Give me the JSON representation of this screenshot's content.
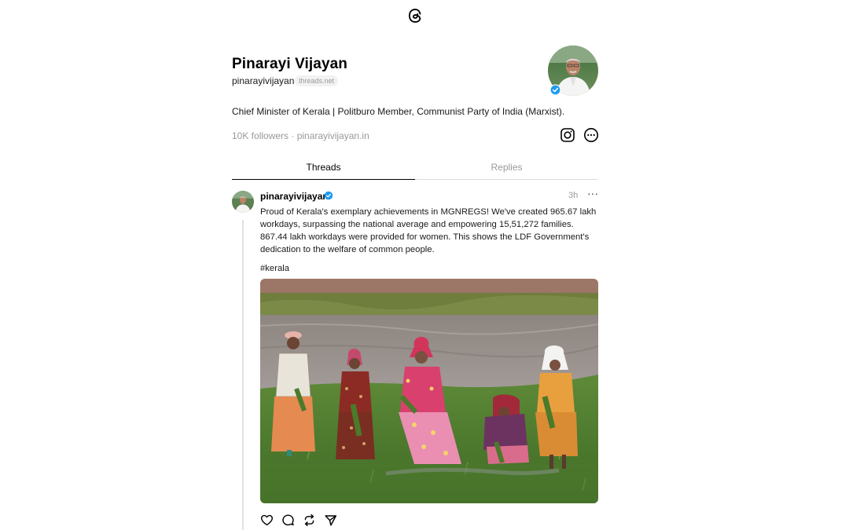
{
  "profile": {
    "name": "Pinarayi Vijayan",
    "handle": "pinarayivijayan",
    "domain_badge": "threads.net",
    "bio": "Chief Minister of Kerala | Politburo Member, Communist Party of India (Marxist).",
    "meta": "10K followers · pinarayivijayan.in"
  },
  "tabs": [
    {
      "label": "Threads",
      "active": true
    },
    {
      "label": "Replies",
      "active": false
    }
  ],
  "post": {
    "author": "pinarayivijayan",
    "time": "3h",
    "more": "···",
    "text": "Proud of Kerala's exemplary achievements in MGNREGS! We've created 965.67 lakh workdays, surpassing the national average and empowering 15,51,272 families. 867.44 lakh workdays were provided for women. This shows the LDF Government's dedication to the welfare of common people.",
    "hashtag": "#kerala"
  },
  "icons": {
    "top": "threads-logo-icon",
    "verified": "verified-badge-icon",
    "profile_actions": [
      "instagram-icon",
      "more-circle-icon"
    ],
    "post_actions": [
      "like-icon",
      "reply-icon",
      "repost-icon",
      "share-icon"
    ]
  },
  "colors": {
    "verified": "#1d9bf0",
    "muted_text": "#999999",
    "primary_text": "#000000"
  }
}
